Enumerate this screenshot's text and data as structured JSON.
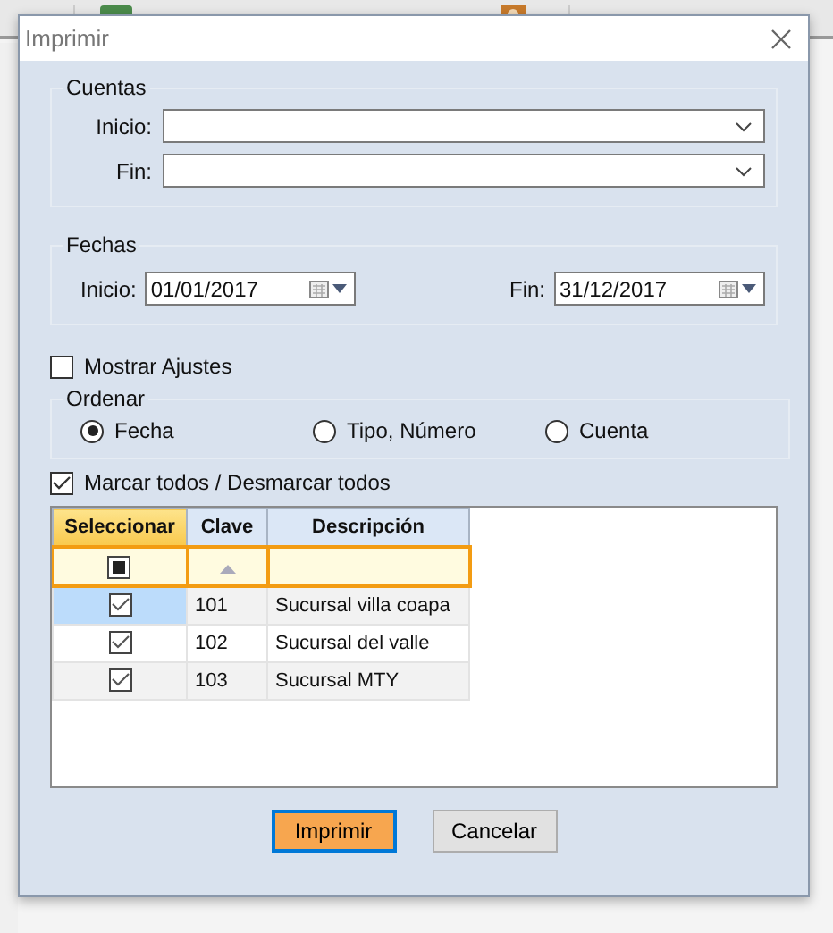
{
  "dialog": {
    "title": "Imprimir",
    "cuentas": {
      "legend": "Cuentas",
      "fields": [
        {
          "label": "Inicio:"
        },
        {
          "label": "Fin:"
        }
      ]
    },
    "fechas": {
      "legend": "Fechas",
      "fields": [
        {
          "label": "Inicio:",
          "value": "01/01/2017"
        },
        {
          "label": "Fin:",
          "value": "31/12/2017"
        }
      ]
    },
    "mostrar_ajustes": {
      "label": "Mostrar Ajustes",
      "checked": false
    },
    "ordenar": {
      "legend": "Ordenar",
      "options": [
        {
          "label": "Fecha",
          "selected": true
        },
        {
          "label": "Tipo, Número",
          "selected": false
        },
        {
          "label": "Cuenta",
          "selected": false
        }
      ]
    },
    "marcar_todos": {
      "label": "Marcar todos / Desmarcar todos",
      "checked": true
    },
    "table": {
      "columns": [
        "Seleccionar",
        "Clave",
        "Descripción"
      ],
      "filter_checked": true,
      "rows": [
        {
          "checked": true,
          "selected": true,
          "clave": "101",
          "descripcion": "Sucursal villa coapa"
        },
        {
          "checked": true,
          "selected": false,
          "clave": "102",
          "descripcion": "Sucursal del valle"
        },
        {
          "checked": true,
          "selected": false,
          "clave": "103",
          "descripcion": "Sucursal MTY"
        }
      ]
    },
    "buttons": [
      {
        "label": "Imprimir",
        "kind": "primary"
      },
      {
        "label": "Cancelar",
        "kind": "normal"
      }
    ]
  }
}
